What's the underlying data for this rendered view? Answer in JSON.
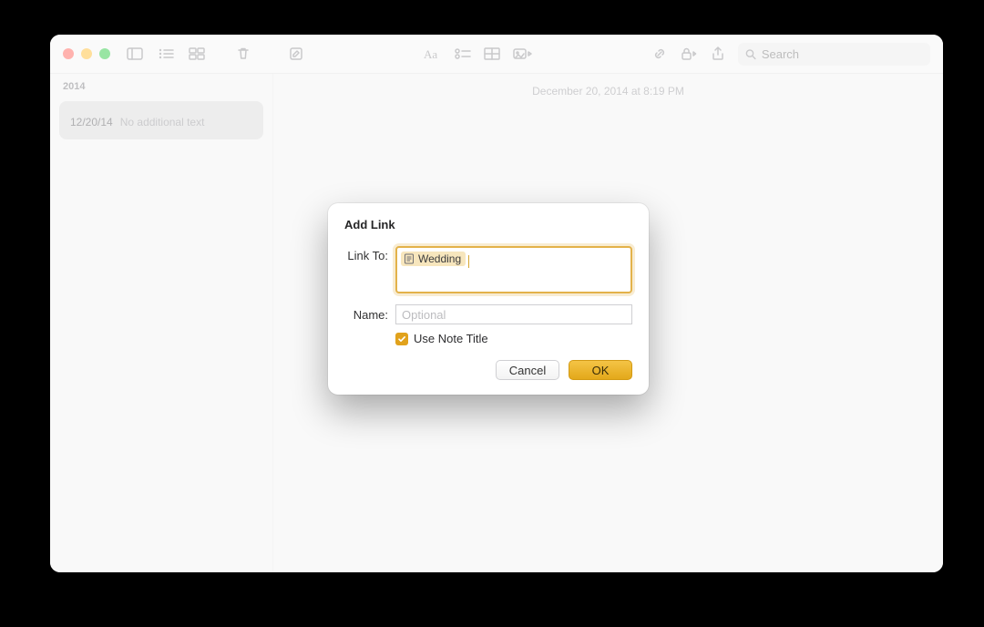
{
  "sidebar": {
    "year": "2014",
    "note": {
      "date": "12/20/14",
      "snippet": "No additional text"
    }
  },
  "editor": {
    "timestamp": "December 20, 2014 at 8:19 PM"
  },
  "toolbar": {
    "search_placeholder": "Search"
  },
  "modal": {
    "title": "Add Link",
    "link_to_label": "Link To:",
    "token": "Wedding",
    "name_label": "Name:",
    "name_placeholder": "Optional",
    "checkbox_label": "Use Note Title",
    "cancel": "Cancel",
    "ok": "OK"
  }
}
